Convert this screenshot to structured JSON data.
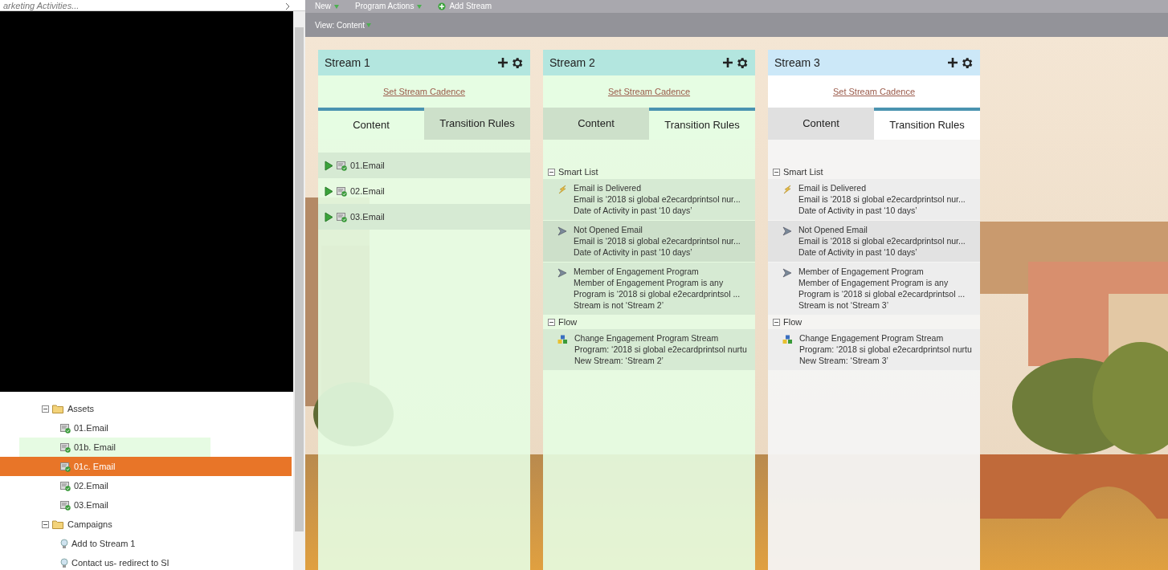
{
  "sidebar": {
    "search": {
      "value": "arketing Activities..."
    },
    "tree": [
      {
        "label": "Assets",
        "kind": "folder",
        "expanded": true,
        "children": [
          {
            "label": "01.Email",
            "kind": "email",
            "selected": false,
            "highlighted": false
          },
          {
            "label": "01b. Email",
            "kind": "email",
            "selected": false,
            "highlighted": true
          },
          {
            "label": "01c. Email",
            "kind": "email",
            "selected": true,
            "highlighted": false
          },
          {
            "label": "02.Email",
            "kind": "email",
            "selected": false,
            "highlighted": false
          },
          {
            "label": "03.Email",
            "kind": "email",
            "selected": false,
            "highlighted": false
          }
        ]
      },
      {
        "label": "Campaigns",
        "kind": "folder",
        "expanded": true,
        "children": [
          {
            "label": "Add to Stream 1",
            "kind": "campaign",
            "selected": false,
            "highlighted": false
          },
          {
            "label": "Contact us- redirect to SI",
            "kind": "campaign",
            "selected": false,
            "highlighted": false
          }
        ]
      }
    ]
  },
  "toolbar": [
    {
      "label": "New",
      "kind": "menu"
    },
    {
      "label": "Program Actions",
      "kind": "menu"
    },
    {
      "label": "Add Stream",
      "kind": "add"
    }
  ],
  "view_bar": {
    "label": "View: Content"
  },
  "streams": [
    {
      "title": "Stream 1",
      "selected": false,
      "cadence_link": "Set Stream Cadence",
      "tabs": [
        {
          "label": "Content",
          "selected": true
        },
        {
          "label": "Transition Rules",
          "selected": false
        }
      ],
      "content_items": [
        {
          "label": "01.Email"
        },
        {
          "label": "02.Email"
        },
        {
          "label": "03.Email"
        }
      ]
    },
    {
      "title": "Stream 2",
      "selected": false,
      "cadence_link": "Set Stream Cadence",
      "tabs": [
        {
          "label": "Content",
          "selected": false
        },
        {
          "label": "Transition Rules",
          "selected": true
        }
      ],
      "sections": [
        {
          "title": "Smart List",
          "expanded": true,
          "items": [
            {
              "kind": "trigger",
              "lines": [
                "Email is Delivered",
                "Email is ‘2018 si global e2ecardprintsol nur...",
                "Date of Activity in past ‘10 days’"
              ]
            },
            {
              "kind": "filter",
              "lines": [
                "Not Opened Email",
                "Email is ‘2018 si global e2ecardprintsol nur...",
                "Date of Activity in past ‘10 days’"
              ]
            },
            {
              "kind": "filter",
              "lines": [
                "Member of Engagement Program",
                "Member of Engagement Program is any",
                "Program is ‘2018 si global e2ecardprintsol ...",
                "Stream is not ‘Stream 2’"
              ]
            }
          ]
        },
        {
          "title": "Flow",
          "expanded": true,
          "items": [
            {
              "kind": "flow",
              "lines": [
                "Change Engagement Program Stream",
                "Program: ‘2018 si global e2ecardprintsol nurtu",
                "New Stream: ‘Stream 2’"
              ]
            }
          ]
        }
      ]
    },
    {
      "title": "Stream 3",
      "selected": true,
      "cadence_link": "Set Stream Cadence",
      "tabs": [
        {
          "label": "Content",
          "selected": false
        },
        {
          "label": "Transition Rules",
          "selected": true
        }
      ],
      "sections": [
        {
          "title": "Smart List",
          "expanded": true,
          "items": [
            {
              "kind": "trigger",
              "lines": [
                "Email is Delivered",
                "Email is ‘2018 si global e2ecardprintsol nur...",
                "Date of Activity in past ‘10 days’"
              ]
            },
            {
              "kind": "filter",
              "lines": [
                "Not Opened Email",
                "Email is ‘2018 si global e2ecardprintsol nur...",
                "Date of Activity in past ‘10 days’"
              ]
            },
            {
              "kind": "filter",
              "lines": [
                "Member of Engagement Program",
                "Member of Engagement Program is any",
                "Program is ‘2018 si global e2ecardprintsol ...",
                "Stream is not ‘Stream 3’"
              ]
            }
          ]
        },
        {
          "title": "Flow",
          "expanded": true,
          "items": [
            {
              "kind": "flow",
              "lines": [
                "Change Engagement Program Stream",
                "Program: ‘2018 si global e2ecardprintsol nurtu",
                "New Stream: ‘Stream 3’"
              ]
            }
          ]
        }
      ]
    }
  ]
}
